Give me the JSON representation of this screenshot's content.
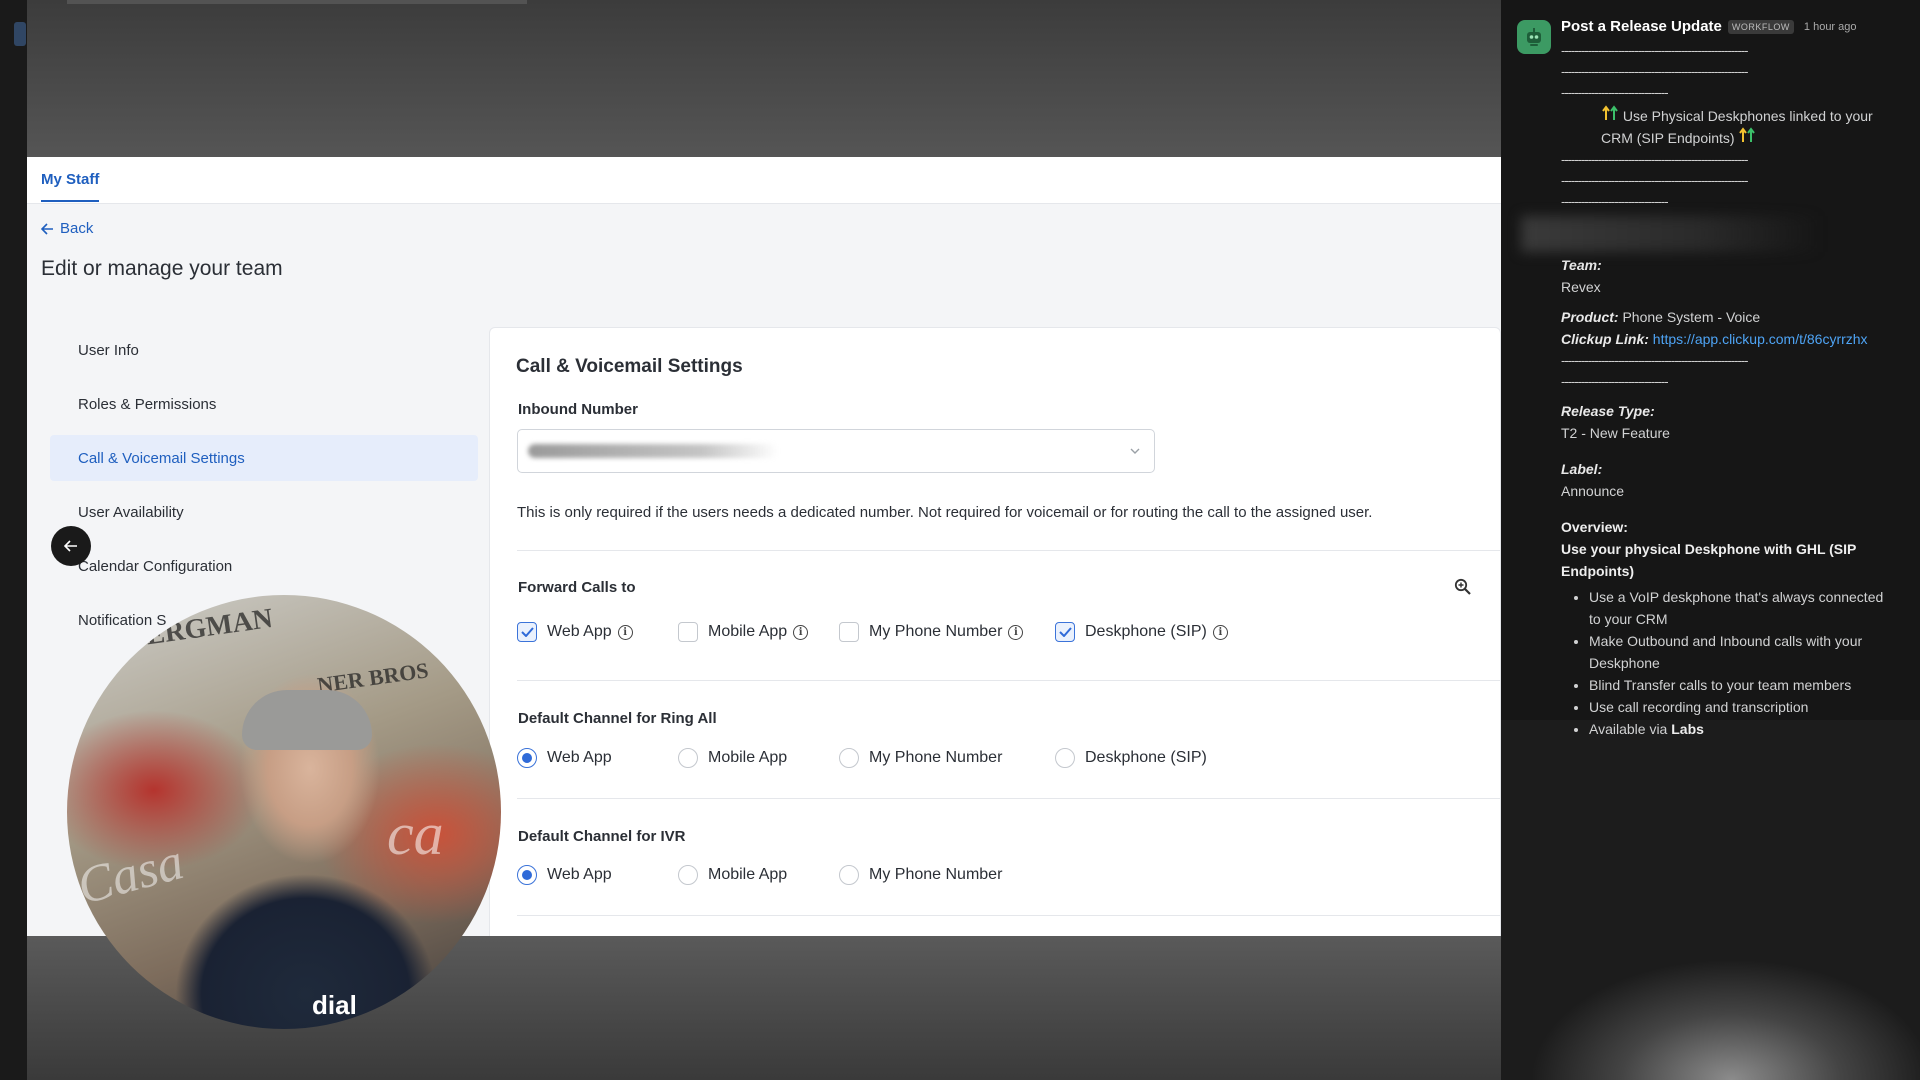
{
  "app": {
    "tab_label": "My Staff",
    "back_label": "Back",
    "page_title": "Edit or manage your team",
    "nav_items": [
      {
        "label": "User Info",
        "active": false
      },
      {
        "label": "Roles & Permissions",
        "active": false
      },
      {
        "label": "Call & Voicemail Settings",
        "active": true
      },
      {
        "label": "User Availability",
        "active": false
      },
      {
        "label": "Calendar Configuration",
        "active": false
      },
      {
        "label": "Notification S",
        "active": false
      }
    ],
    "section_title": "Call & Voicemail Settings",
    "inbound_label": "Inbound Number",
    "inbound_help": "This is only required if the users needs a dedicated number. Not required for voicemail or for routing the call to the assigned user.",
    "forward_label": "Forward Calls to",
    "forward_options": [
      {
        "label": "Web App",
        "checked": true
      },
      {
        "label": "Mobile App",
        "checked": false
      },
      {
        "label": "My Phone Number",
        "checked": false
      },
      {
        "label": "Deskphone (SIP)",
        "checked": true
      }
    ],
    "ring_all_label": "Default Channel for Ring All",
    "ring_all_options": [
      {
        "label": "Web App",
        "selected": true
      },
      {
        "label": "Mobile App",
        "selected": false
      },
      {
        "label": "My Phone Number",
        "selected": false
      },
      {
        "label": "Deskphone (SIP)",
        "selected": false
      }
    ],
    "ivr_label": "Default Channel for IVR",
    "ivr_options": [
      {
        "label": "Web App",
        "selected": true
      },
      {
        "label": "Mobile App",
        "selected": false
      },
      {
        "label": "My Phone Number",
        "selected": false
      }
    ],
    "accent_color": "#1f5fbf"
  },
  "webcam": {
    "poster_text": "BERGMAN",
    "poster_text_2": "NER BROS",
    "script_right": "ca",
    "script_left": "Casa",
    "shirt_text": "dial"
  },
  "slack": {
    "sender": "Post a Release Update",
    "badge": "WORKFLOW",
    "time": "1 hour ago",
    "dash_line": "--------------------------------------------------------",
    "dash_short": "--------------------------------",
    "headline": "Use Physical Deskphones linked to your CRM (SIP Endpoints)",
    "team_label": "Team:",
    "team_value": "Revex",
    "product_label": "Product:",
    "product_value": "Phone System - Voice",
    "clickup_label": "Clickup Link:",
    "clickup_value": "https://app.clickup.com/t/86cyrrzhx",
    "release_type_label": "Release Type:",
    "release_type_value": "T2 - New Feature",
    "label_label": "Label:",
    "label_value": "Announce",
    "overview_label": "Overview:",
    "overview_title": "Use your physical Deskphone with GHL (SIP Endpoints)",
    "bullets": [
      "Use a VoIP deskphone that's always connected to your CRM",
      "Make Outbound and Inbound calls with your Deskphone",
      "Blind Transfer calls to your team members",
      "Use call recording and transcription"
    ],
    "last_bullet_prefix": "Available via",
    "last_bullet_bold": "Labs",
    "link_color": "#4ea4f5"
  }
}
